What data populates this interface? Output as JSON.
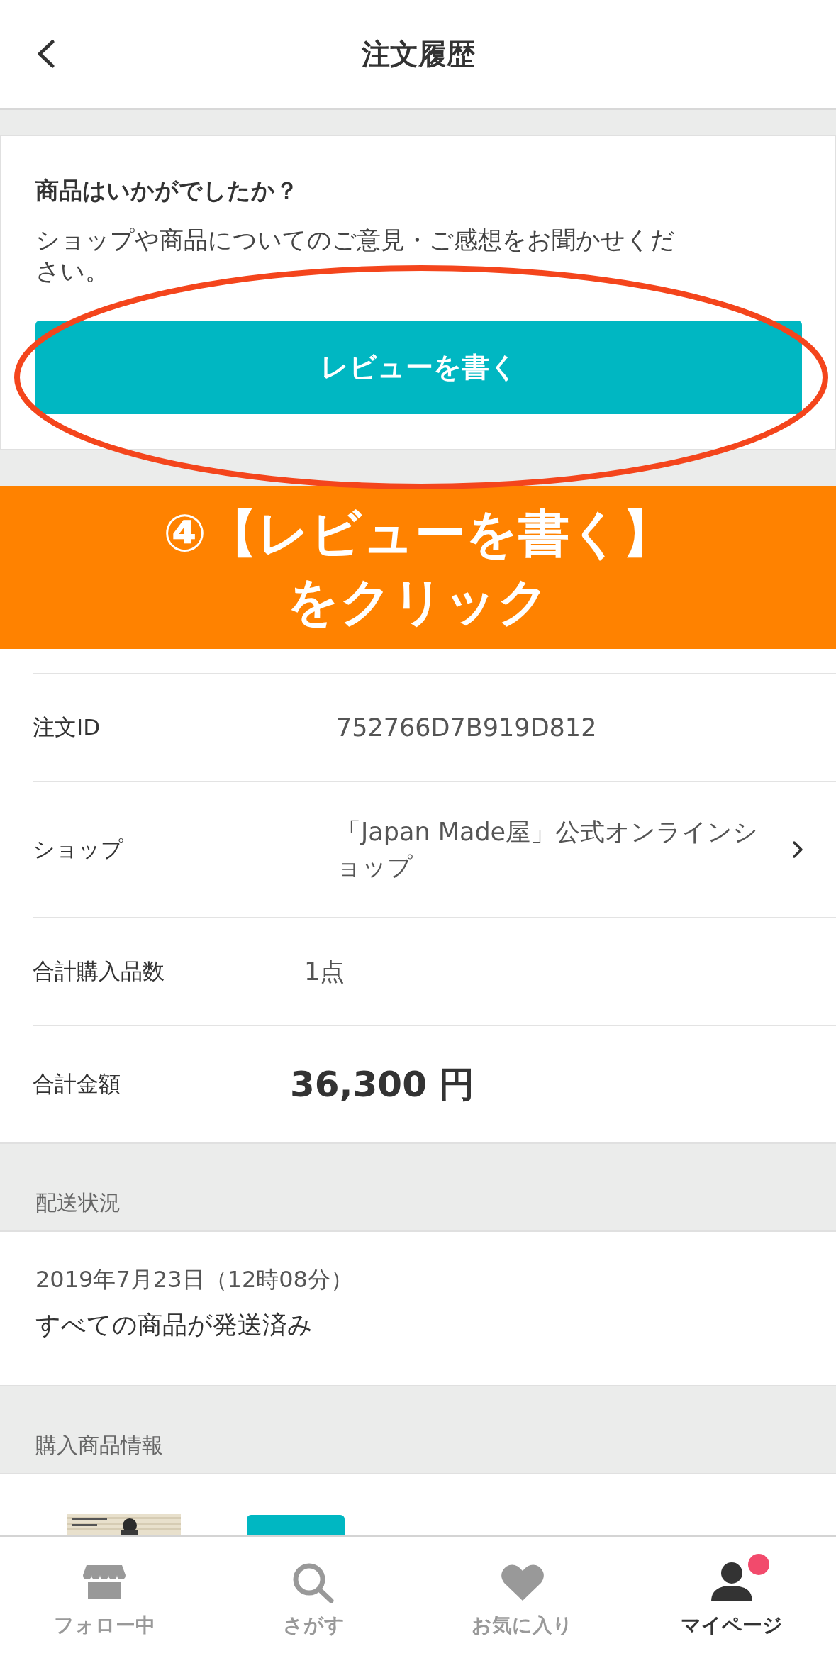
{
  "header": {
    "title": "注文履歴"
  },
  "review_card": {
    "heading": "商品はいかがでしたか？",
    "message": "ショップや商品についてのご意見・ご感想をお聞かせください。",
    "button": "レビューを書く"
  },
  "annotation": {
    "lines": [
      "④【レビューを書く】",
      "をクリック"
    ]
  },
  "order_details": [
    {
      "label": "注文ID",
      "value": "752766D7B919D812",
      "kind": "plain"
    },
    {
      "label": "ショップ",
      "value": "「Japan Made屋」公式オンラインショップ",
      "kind": "link"
    },
    {
      "label": "合計購入品数",
      "value": "1点",
      "kind": "plain"
    },
    {
      "label": "合計金額",
      "value": "36,300 円",
      "kind": "amount"
    }
  ],
  "shipping": {
    "section_title": "配送状況",
    "datetime": "2019年7月23日（12時08分）",
    "status": "すべての商品が発送済み"
  },
  "purchased_items": {
    "section_title": "購入商品情報"
  },
  "tab_bar": [
    {
      "label": "フォロー中",
      "selected": false,
      "notification": false
    },
    {
      "label": "さがす",
      "selected": false,
      "notification": false
    },
    {
      "label": "お気に入り",
      "selected": false,
      "notification": false
    },
    {
      "label": "マイページ",
      "selected": true,
      "notification": true
    }
  ]
}
